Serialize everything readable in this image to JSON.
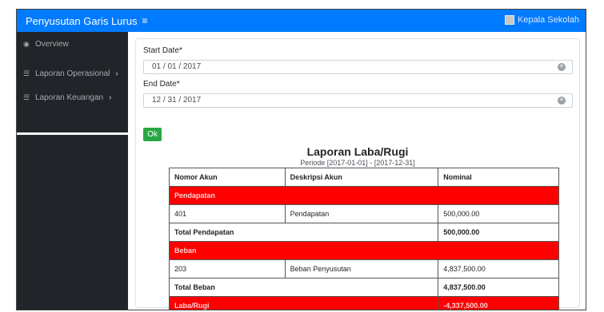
{
  "app": {
    "title": "Penyusutan Garis Lurus",
    "menu_icon": "hamburger-icon",
    "user_name": "Kepala Sekolah",
    "brand_color": "#007bff"
  },
  "sidebar": {
    "items": [
      {
        "label": "Overview",
        "icon": "dashboard-icon"
      },
      {
        "label": "Laporan Operasional",
        "icon": "list-icon"
      },
      {
        "label": "Laporan Keuangan",
        "icon": "list-icon"
      }
    ]
  },
  "form": {
    "start_label": "Start Date*",
    "start_value": "01 / 01 / 2017",
    "end_label": "End Date*",
    "end_value": "12 / 31 / 2017",
    "ok_label": "Ok"
  },
  "report": {
    "title": "Laporan Laba/Rugi",
    "period": "Periode [2017-01-01] - [2017-12-31]",
    "headers": [
      "Nomor Akun",
      "Deskripsi Akun",
      "Nominal"
    ],
    "pendapatan_section": "Pendapatan",
    "pendapatan_row": {
      "account": "401",
      "description": "Pendapatan",
      "amount": "500,000.00"
    },
    "total_pendapatan_label": "Total Pendapatan",
    "total_pendapatan_value": "500,000.00",
    "beban_section": "Beban",
    "beban_row": {
      "account": "203",
      "description": "Beban Penyusutan",
      "amount": "4,837,500.00"
    },
    "total_beban_label": "Total Beban",
    "total_beban_value": "4,837,500.00",
    "laba_label": "Laba/Rugi",
    "laba_value": "-4,337,500.00",
    "highlight_color": "#ff0000"
  }
}
